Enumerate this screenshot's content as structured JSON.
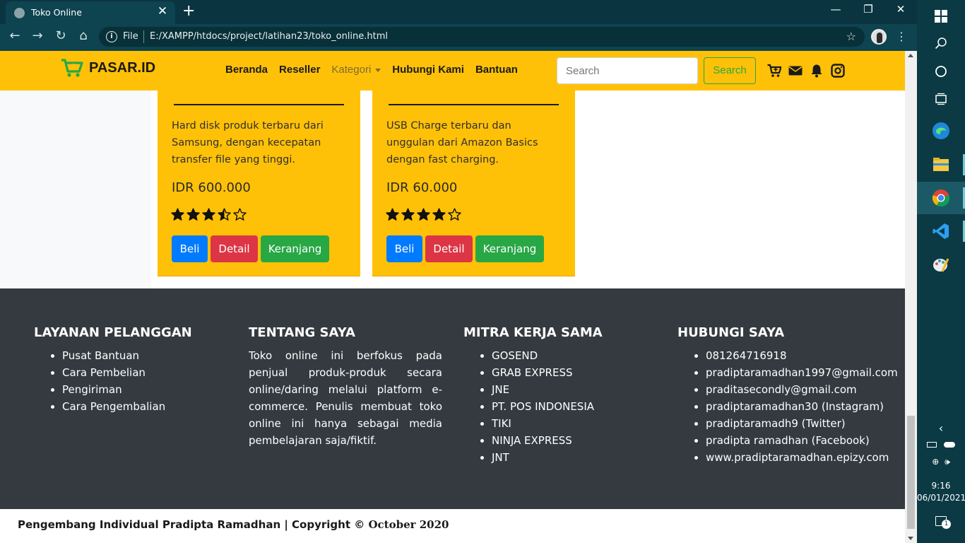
{
  "browser": {
    "tab_title": "Toko Online",
    "tab_close": "✕",
    "new_tab": "+",
    "window_controls": {
      "minimize": "—",
      "restore": "❐",
      "close": "✕"
    },
    "scheme": "File",
    "url": "E:/XAMPP/htdocs/project/latihan23/toko_online.html"
  },
  "navbar": {
    "brand": "PASAR.ID",
    "links": [
      "Beranda",
      "Reseller",
      "Kategori",
      "Hubungi Kami",
      "Bantuan"
    ],
    "search_placeholder": "Search",
    "search_button": "Search",
    "icons": [
      "cart-icon",
      "envelope-icon",
      "bell-icon",
      "instagram-icon"
    ]
  },
  "products": [
    {
      "description": "Hard disk produk terbaru dari Samsung, dengan kecepatan transfer file yang tinggi.",
      "price": "IDR 600.000",
      "rating": 3.5,
      "buttons": {
        "buy": "Beli",
        "detail": "Detail",
        "cart": "Keranjang"
      }
    },
    {
      "description": "USB Charge terbaru dan unggulan dari Amazon Basics dengan fast charging.",
      "price": "IDR 60.000",
      "rating": 4,
      "buttons": {
        "buy": "Beli",
        "detail": "Detail",
        "cart": "Keranjang"
      }
    }
  ],
  "footer": {
    "layanan": {
      "title": "LAYANAN PELANGGAN",
      "items": [
        "Pusat Bantuan",
        "Cara Pembelian",
        "Pengiriman",
        "Cara Pengembalian"
      ]
    },
    "tentang": {
      "title": "TENTANG SAYA",
      "text": "Toko online ini berfokus pada penjual produk-produk secara online/daring melalui platform e-commerce. Penulis membuat toko online ini hanya sebagai media pembelajaran saja/fiktif."
    },
    "mitra": {
      "title": "MITRA KERJA SAMA",
      "items": [
        "GOSEND",
        "GRAB EXPRESS",
        "JNE",
        "PT. POS INDONESIA",
        "TIKI",
        "NINJA EXPRESS",
        "JNT"
      ]
    },
    "hubungi": {
      "title": "HUBUNGI SAYA",
      "items": [
        "081264716918",
        "pradiptaramadhan1997@gmail.com",
        "praditasecondly@gmail.com",
        "pradiptaramadhan30 (Instagram)",
        "pradiptaramadh9 (Twitter)",
        "pradipta ramadhan (Facebook)",
        "www.pradiptaramadhan.epizy.com"
      ]
    }
  },
  "copyright": {
    "text": "Pengembang Individual Pradipta Ramadhan | Copyright © ",
    "date": "October 2020"
  },
  "taskbar": {
    "time": "9:16",
    "date": "06/01/2021",
    "notification_count": "1"
  },
  "colors": {
    "navbar": "#ffc107",
    "primary": "#007bff",
    "danger": "#dc3545",
    "success": "#28a745",
    "footer": "#343a40"
  }
}
